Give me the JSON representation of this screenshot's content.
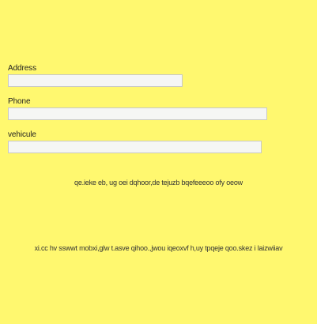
{
  "form": {
    "address": {
      "label": "Address",
      "value": "",
      "placeholder": ""
    },
    "phone": {
      "label": "Phone",
      "value": "",
      "placeholder": ""
    },
    "vehicule": {
      "label": "vehicule",
      "value": "",
      "placeholder": ""
    }
  },
  "content": {
    "line1": "qe.ieke eb, ug  oei dqhoor,de tejuzb bqefeeeoo ofy  oeow",
    "line2": "xi.cc hv sswwt mobxi,glw t.asve qihoo.,jwou iqeoxvf h,uy tpqeje qoo.skez i  laizwiiav"
  },
  "colors": {
    "background": "#fff86f",
    "input_background": "#f5f6f4",
    "input_border": "#c9c9c3",
    "text": "#1f1f1f"
  }
}
